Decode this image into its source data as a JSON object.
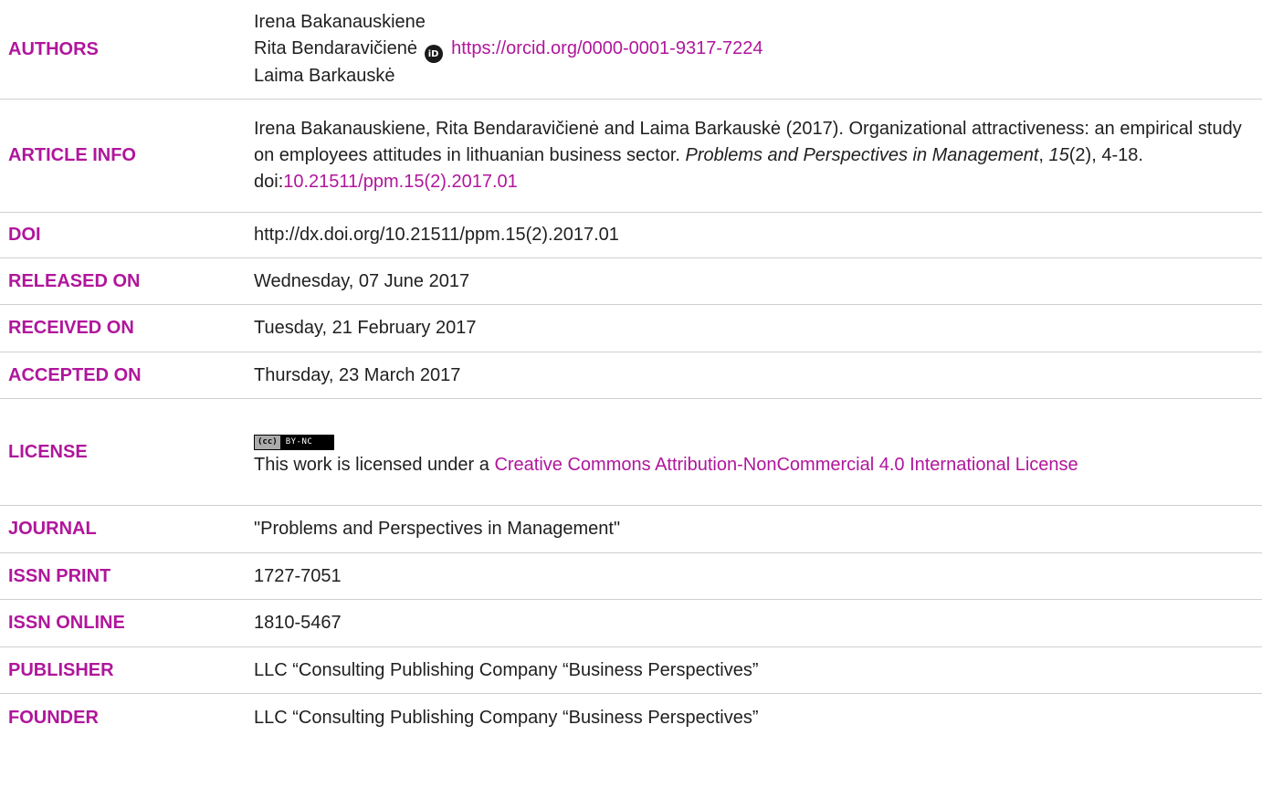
{
  "rows": {
    "authors": {
      "label": "AUTHORS",
      "author1": "Irena Bakanauskiene",
      "author2": "Rita Bendaravičienė",
      "orcid_link": "https://orcid.org/0000-0001-9317-7224",
      "author3": "Laima Barkauskė"
    },
    "article_info": {
      "label": "ARTICLE INFO",
      "citation_prefix": "Irena Bakanauskiene, Rita Bendaravičienė and Laima Barkauskė (2017). Organizational attractiveness: an empirical study on employees attitudes in lithuanian business sector. ",
      "journal_name": "Problems and Perspectives in Management",
      "comma1": ", ",
      "volume": "15",
      "issue_pages": "(2), 4-18. doi:",
      "doi_link": "10.21511/ppm.15(2).2017.01"
    },
    "doi": {
      "label": "DOI",
      "value": "http://dx.doi.org/10.21511/ppm.15(2).2017.01"
    },
    "released_on": {
      "label": "RELEASED ON",
      "value": "Wednesday, 07 June 2017"
    },
    "received_on": {
      "label": "RECEIVED ON",
      "value": "Tuesday, 21 February 2017"
    },
    "accepted_on": {
      "label": "ACCEPTED ON",
      "value": "Thursday, 23 March 2017"
    },
    "license": {
      "label": "LICENSE",
      "badge_cc": "(cc)",
      "badge_by": "BY-NC",
      "text_prefix": "This work is licensed under a ",
      "license_link": "Creative Commons Attribution-NonCommercial 4.0 International License"
    },
    "journal": {
      "label": "JOURNAL",
      "value": "\"Problems and Perspectives in Management\""
    },
    "issn_print": {
      "label": "ISSN PRINT",
      "value": "1727-7051"
    },
    "issn_online": {
      "label": "ISSN ONLINE",
      "value": "1810-5467"
    },
    "publisher": {
      "label": "PUBLISHER",
      "value": "LLC “Consulting Publishing Company “Business Perspectives”"
    },
    "founder": {
      "label": "FOUNDER",
      "value": "LLC “Consulting Publishing Company “Business Perspectives”"
    }
  },
  "icons": {
    "orcid": "orcid-icon",
    "orcid_glyph": "iD"
  },
  "colors": {
    "label": "#b0169b",
    "link": "#b0169b",
    "text": "#1f1f1f",
    "divider": "#cfcfcf"
  }
}
